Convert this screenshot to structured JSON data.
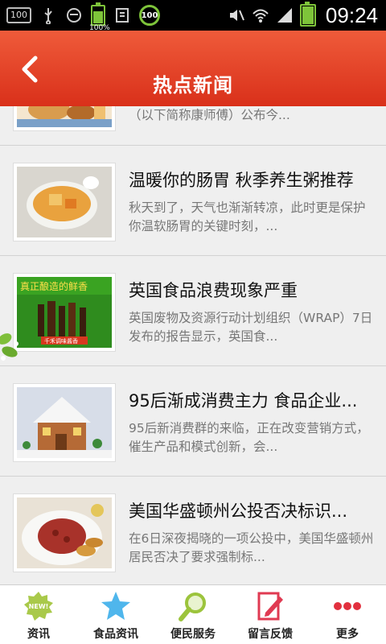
{
  "status_bar": {
    "left_badges": [
      "100",
      "100%",
      "100"
    ],
    "time": "09:24"
  },
  "header": {
    "title": "热点新闻",
    "accent_color": "#e2432a"
  },
  "news": [
    {
      "title": "",
      "desc": "（以下简称康师傅）公布今..."
    },
    {
      "title": "温暖你的肠胃 秋季养生粥推荐",
      "desc": "秋天到了，天气也渐渐转凉，此时更是保护你温软肠胃的关键时刻，..."
    },
    {
      "title": "英国食品浪费现象严重",
      "desc": "英国废物及资源行动计划组织（WRAP）7日发布的报告显示，英国食..."
    },
    {
      "title": "95后渐成消费主力 食品企业...",
      "desc": "95后新消费群的来临，正在改变营销方式，催生产品和模式创新，会..."
    },
    {
      "title": "美国华盛顿州公投否决标识...",
      "desc": "在6日深夜揭晓的一项公投中，美国华盛顿州居民否决了要求强制标..."
    }
  ],
  "thumb_texts": {
    "ad_line1": "真正酿造的鲜香",
    "ad_line2": "千禾调味酱香",
    "new_badge": "NEW!"
  },
  "tabs": [
    {
      "label": "资讯",
      "icon": "new-badge-icon"
    },
    {
      "label": "食品资讯",
      "icon": "star-icon"
    },
    {
      "label": "便民服务",
      "icon": "magnifier-icon"
    },
    {
      "label": "留言反馈",
      "icon": "edit-note-icon"
    },
    {
      "label": "更多",
      "icon": "more-dots-icon"
    }
  ]
}
